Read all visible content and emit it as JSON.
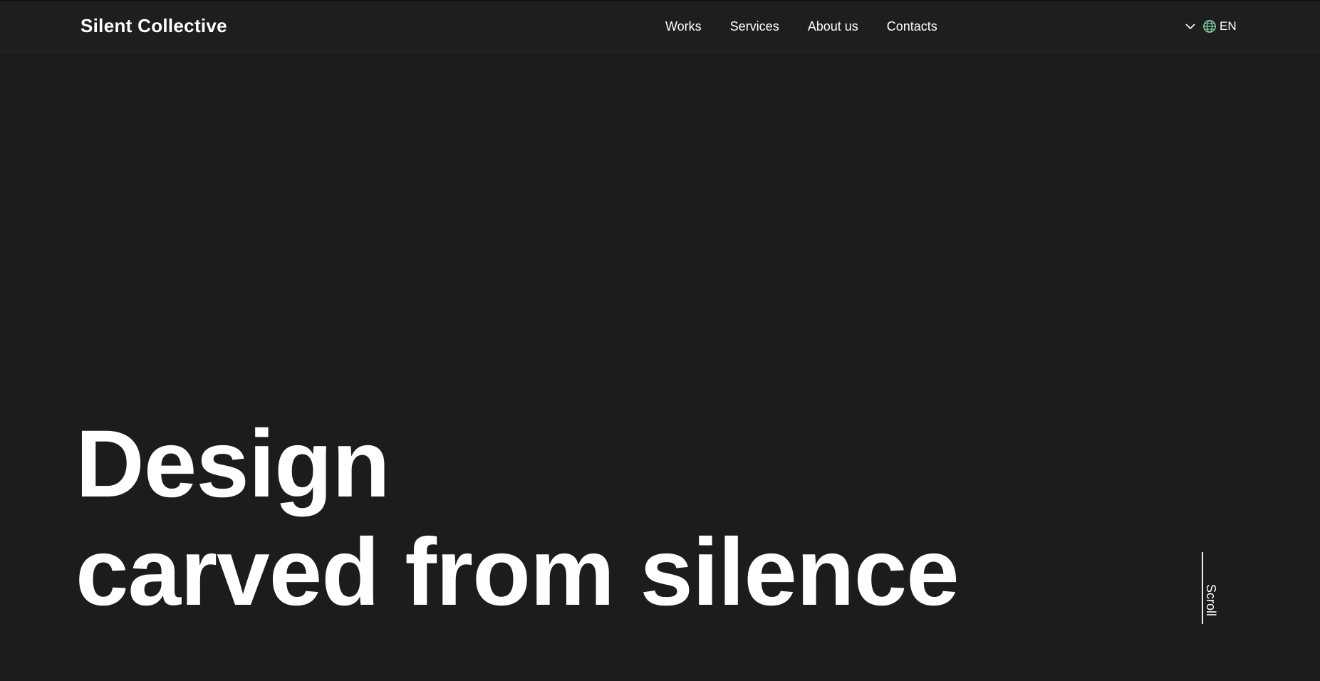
{
  "header": {
    "logo": "Silent Collective",
    "nav": [
      {
        "label": "Works"
      },
      {
        "label": "Services"
      },
      {
        "label": "About us"
      },
      {
        "label": "Contacts"
      }
    ],
    "language": {
      "current": "EN",
      "chevron_icon": "chevron-down-icon",
      "globe_icon": "globe-icon",
      "globe_color": "#7fd6a3"
    }
  },
  "hero": {
    "line1": "Design",
    "line2": "carved from silence"
  },
  "scroll": {
    "label": "Scroll"
  },
  "colors": {
    "background": "#1c1c1c",
    "header_background": "#1e1e1e",
    "text": "#ffffff",
    "accent": "#7fd6a3"
  }
}
